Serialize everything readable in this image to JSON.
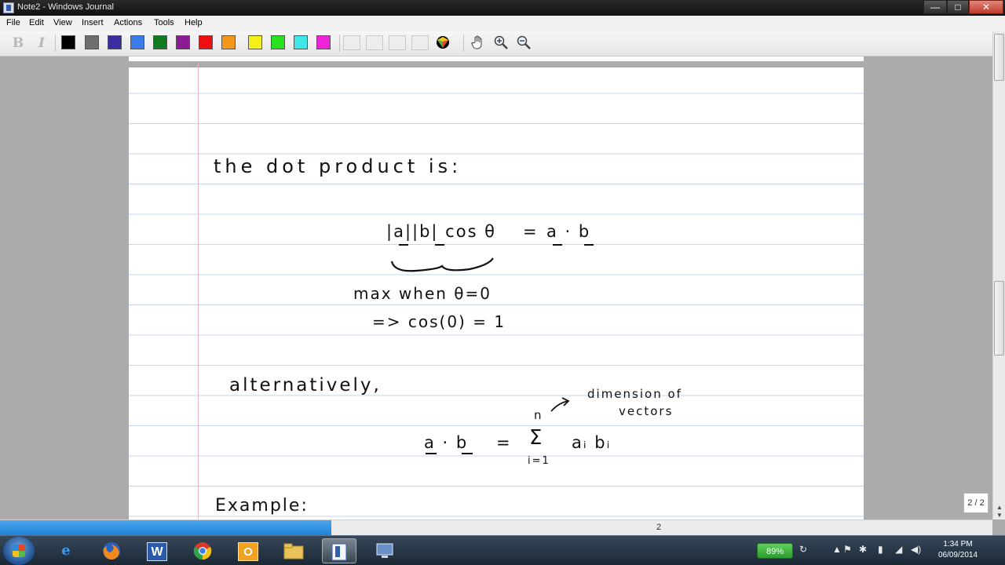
{
  "window": {
    "title": "Note2 - Windows Journal",
    "minimize": "—",
    "maximize": "□",
    "close": "✕"
  },
  "menu": [
    "File",
    "Edit",
    "View",
    "Insert",
    "Actions",
    "Tools",
    "Help"
  ],
  "toolbar": {
    "bold": "B",
    "italic": "I",
    "pen_colors": [
      "#000000",
      "#6e6e6e",
      "#3a2f9e",
      "#3a7ce8",
      "#117a1e",
      "#8a1b93",
      "#ee1010",
      "#f5971a",
      "#f4f018",
      "#28e21f",
      "#3fe7e9",
      "#ee22d8"
    ],
    "icons": [
      "pen-settings-icon",
      "pan-hand-icon",
      "zoom-in-icon",
      "zoom-out-icon"
    ]
  },
  "note": {
    "line1": "the dot product is:",
    "formula_left": "|a||b| cos θ",
    "formula_eq": "=",
    "formula_right": "a · b",
    "max_note": "max when θ=0",
    "cos_note": "=> cos(0) = 1",
    "alternatively": "alternatively,",
    "sum_left": "a · b",
    "sum_eq": "=",
    "sum_upper": "n",
    "sum_symbol": "Σ",
    "sum_lower": "i=1",
    "sum_terms": "aᵢ bᵢ",
    "annotation_line1": "dimension of",
    "annotation_line2": "vectors",
    "example": "Example:"
  },
  "status": {
    "page_number": "2",
    "page_indicator": "2 / 2"
  },
  "taskbar": {
    "apps": [
      "internet-explorer",
      "firefox",
      "word",
      "chrome",
      "outlook",
      "file-explorer",
      "windows-journal",
      "remote-desktop"
    ],
    "battery": "89%",
    "time": "1:34 PM",
    "date": "06/09/2014"
  }
}
